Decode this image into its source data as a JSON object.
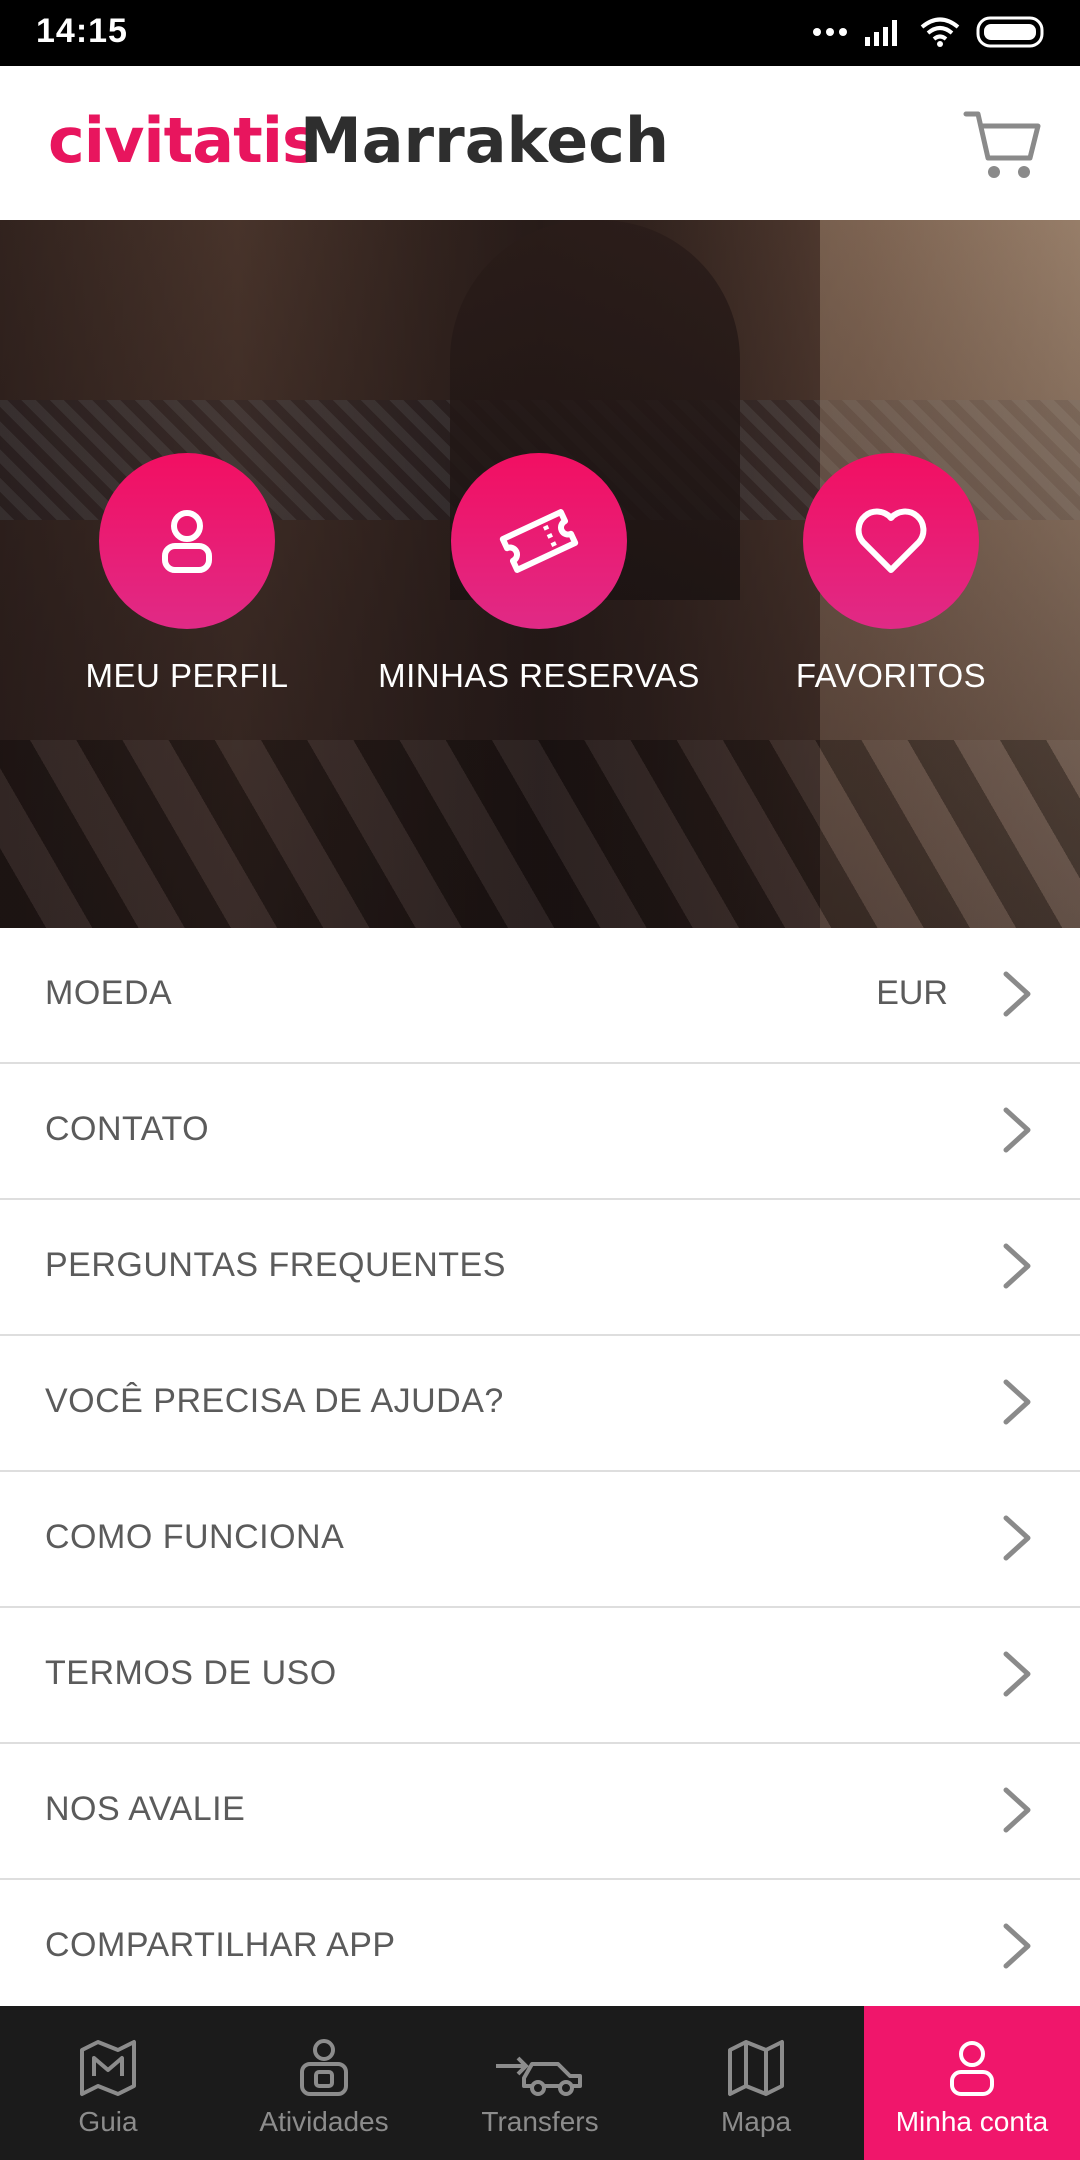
{
  "status_bar": {
    "time": "14:15"
  },
  "header": {
    "brand": "civitatis",
    "city": "Marrakech"
  },
  "hero_actions": [
    {
      "label": "MEU PERFIL",
      "icon": "user-icon"
    },
    {
      "label": "MINHAS RESERVAS",
      "icon": "ticket-icon"
    },
    {
      "label": "FAVORITOS",
      "icon": "heart-icon"
    }
  ],
  "menu": {
    "items": [
      {
        "label": "MOEDA",
        "value": "EUR"
      },
      {
        "label": "CONTATO"
      },
      {
        "label": "PERGUNTAS FREQUENTES"
      },
      {
        "label": "VOCÊ PRECISA DE AJUDA?"
      },
      {
        "label": "COMO FUNCIONA"
      },
      {
        "label": "TERMOS DE USO"
      },
      {
        "label": "NOS AVALIE"
      },
      {
        "label": "COMPARTILHAR APP"
      }
    ]
  },
  "bottom_nav": {
    "items": [
      {
        "label": "Guia",
        "icon": "map-book-icon"
      },
      {
        "label": "Atividades",
        "icon": "activities-icon"
      },
      {
        "label": "Transfers",
        "icon": "car-icon"
      },
      {
        "label": "Mapa",
        "icon": "map-icon"
      },
      {
        "label": "Minha conta",
        "icon": "user-icon",
        "active": true
      }
    ]
  },
  "colors": {
    "brand": "#e8155e",
    "accent": "#f0166b",
    "nav_bg": "#1b1b1b"
  }
}
